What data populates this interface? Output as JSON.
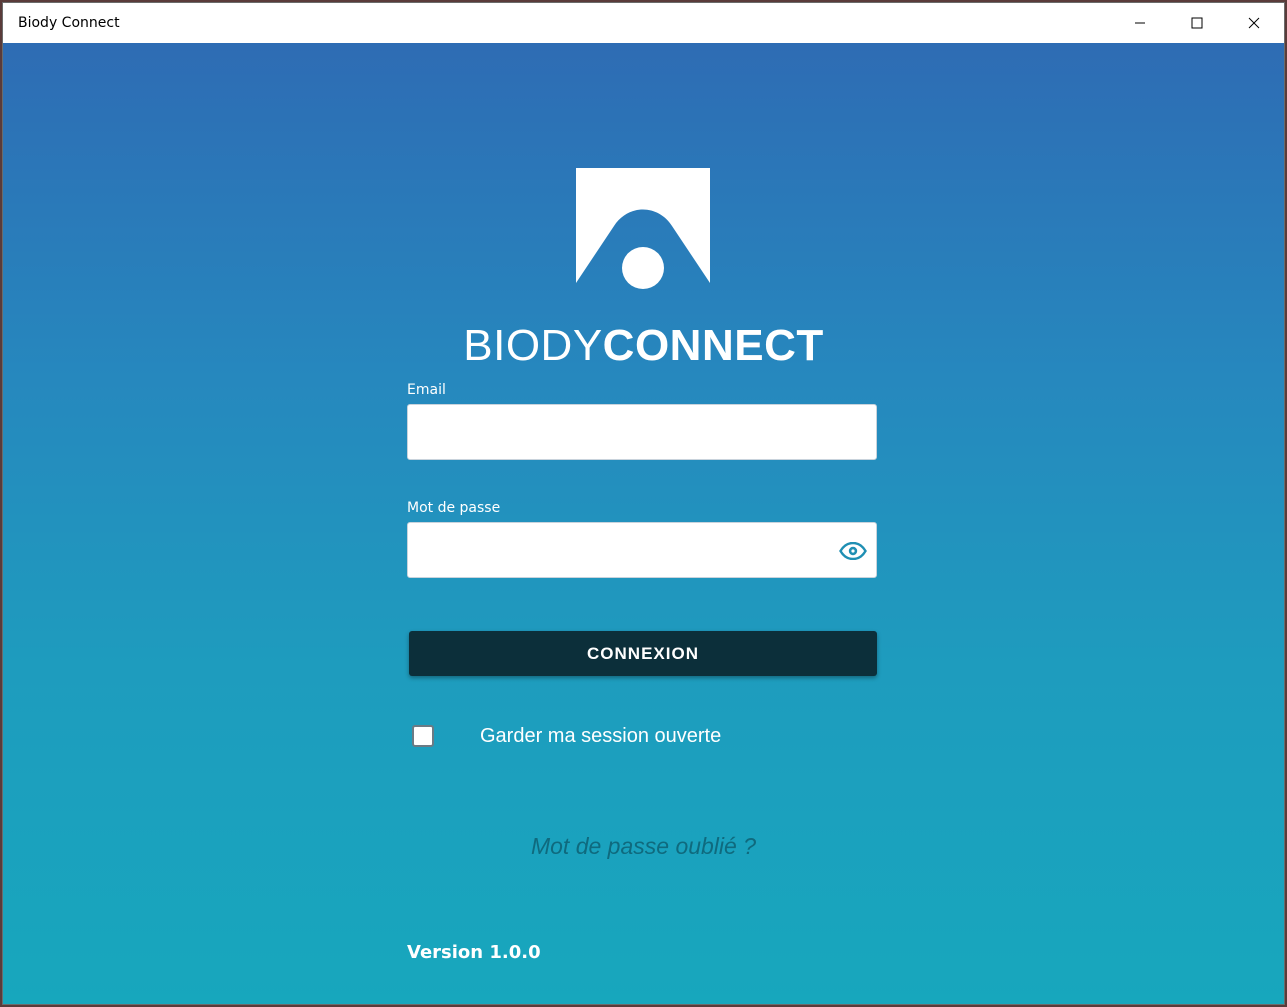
{
  "window": {
    "title": "Biody Connect"
  },
  "brand": {
    "light": "BIODY",
    "bold": "CONNECT"
  },
  "form": {
    "email_label": "Email",
    "email_value": "",
    "email_placeholder": "",
    "password_label": "Mot de passe",
    "password_value": "",
    "password_placeholder": "",
    "submit_label": "CONNEXION",
    "remember_label": "Garder ma session ouverte",
    "remember_checked": false,
    "forgot_label": "Mot de passe oublié ?"
  },
  "footer": {
    "version": "Version 1.0.0"
  },
  "colors": {
    "gradient_top": "#2e6cb4",
    "gradient_bottom": "#17a7bd",
    "button_bg": "#0c2f3a",
    "eye_icon": "#1f8fb3",
    "forgot_link": "#0f6a7e"
  },
  "icons": {
    "logo": "biody-logo-icon",
    "eye": "eye-icon",
    "minimize": "minimize-icon",
    "maximize": "maximize-icon",
    "close": "close-icon"
  }
}
